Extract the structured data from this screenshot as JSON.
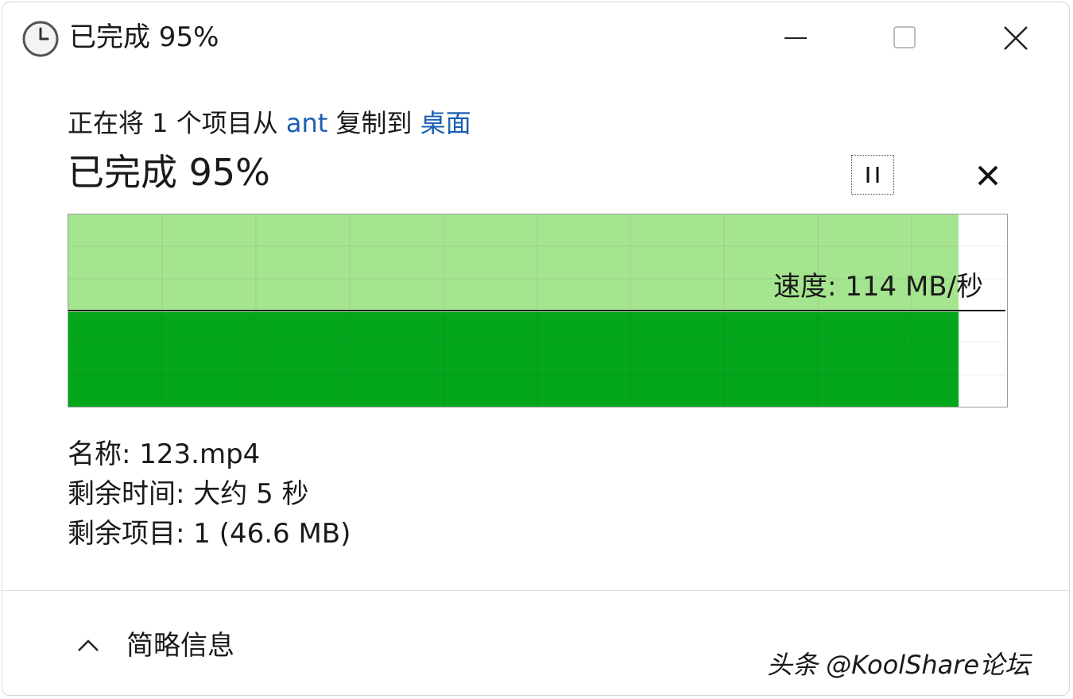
{
  "window": {
    "title": "已完成 95%",
    "title_icon": "clock-icon",
    "controls": {
      "minimize": "minimize-icon",
      "maximize": "maximize-icon",
      "close": "close-icon"
    }
  },
  "copy": {
    "prefix": "正在将 1 个项目从 ",
    "source": "ant",
    "middle": " 复制到 ",
    "destination": "桌面",
    "status": "已完成 95%",
    "progress_fraction": 0.95
  },
  "actions": {
    "pause_icon": "pause-icon",
    "cancel_icon": "x-icon"
  },
  "graph": {
    "speed_label": "速度: 114 MB/秒",
    "fill_done_color": "#a5e58f",
    "fill_speed_color": "#04a61c",
    "speed_fraction": 0.5
  },
  "details": {
    "name": "名称: 123.mp4",
    "time_remaining": "剩余时间: 大约 5 秒",
    "items_remaining": "剩余项目: 1 (46.6 MB)"
  },
  "footer": {
    "toggle_label": "简略信息",
    "chevron": "chevron-up-icon"
  },
  "watermark": "头条 @KoolShare论坛"
}
